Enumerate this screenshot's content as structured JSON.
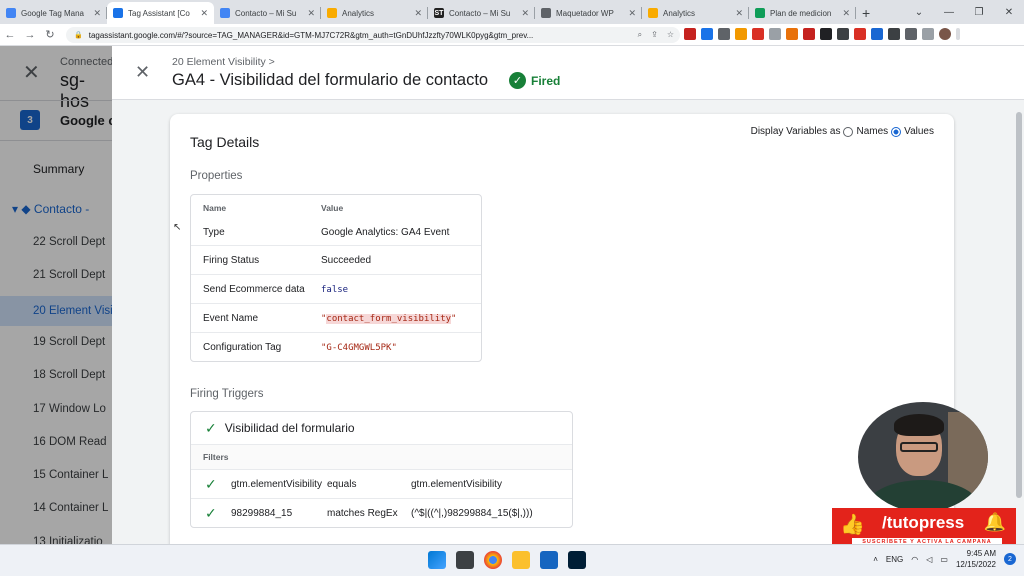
{
  "tabs": [
    {
      "title": "Google Tag Mana",
      "favicon_color": "#4285f4",
      "active": false
    },
    {
      "title": "Tag Assistant [Co",
      "favicon_color": "#1a73e8",
      "active": true
    },
    {
      "title": "Contacto – Mi Su",
      "favicon_color": "#4285f4",
      "active": false
    },
    {
      "title": "Analytics",
      "favicon_color": "#f9ab00",
      "active": false
    },
    {
      "title": "Contacto – Mi Su",
      "favicon_color": "#222222",
      "favicon_text": "ST",
      "active": false
    },
    {
      "title": "Maquetador WP",
      "favicon_color": "#5f6368",
      "active": false
    },
    {
      "title": "Analytics",
      "favicon_color": "#f9ab00",
      "active": false
    },
    {
      "title": "Plan de medicion",
      "favicon_color": "#0f9d58",
      "active": false
    }
  ],
  "browser": {
    "url": "tagassistant.google.com/#/?source=TAG_MANAGER&id=GTM-MJ7C72R&gtm_auth=tGnDUhfJzzfty70WLK0pyg&gtm_prev..."
  },
  "left_panel": {
    "connected_label": "Connected",
    "host": "sg-hos",
    "page_number": "3",
    "page_label": "Google c",
    "summary": "Summary",
    "container": "Contacto -",
    "events": [
      {
        "label": "22 Scroll Dept",
        "selected": false
      },
      {
        "label": "21 Scroll Dept",
        "selected": false
      },
      {
        "label": "20 Element Visi",
        "selected": true
      },
      {
        "label": "19 Scroll Dept",
        "selected": false
      },
      {
        "label": "18 Scroll Dept",
        "selected": false
      },
      {
        "label": "17 Window Lo",
        "selected": false
      },
      {
        "label": "16 DOM Read",
        "selected": false
      },
      {
        "label": "15 Container L",
        "selected": false
      },
      {
        "label": "14 Container L",
        "selected": false
      },
      {
        "label": "13 Initializatio",
        "selected": false
      }
    ]
  },
  "panel": {
    "breadcrumb": "20 Element Visibility >",
    "title": "GA4 - Visibilidad del formulario de contacto",
    "status": "Fired"
  },
  "card": {
    "title": "Tag Details",
    "display_variables_label": "Display Variables as",
    "option_names": "Names",
    "option_values": "Values",
    "selected_option": "Values",
    "properties_heading": "Properties",
    "properties_header": {
      "name": "Name",
      "value": "Value"
    },
    "properties": [
      {
        "name": "Type",
        "value": "Google Analytics: GA4 Event",
        "style": "plain"
      },
      {
        "name": "Firing Status",
        "value": "Succeeded",
        "style": "plain"
      },
      {
        "name": "Send Ecommerce data",
        "value": "false",
        "style": "keyword"
      },
      {
        "name": "Event Name",
        "value": "contact_form_visibility",
        "style": "string-highlight"
      },
      {
        "name": "Configuration Tag",
        "value": "G-C4GMGWL5PK",
        "style": "string"
      }
    ],
    "triggers_heading": "Firing Triggers",
    "trigger_name": "Visibilidad del formulario",
    "filters_label": "Filters",
    "filters": [
      {
        "variable": "gtm.elementVisibility",
        "operator": "equals",
        "value": "gtm.elementVisibility"
      },
      {
        "variable": "98299884_15",
        "operator": "matches RegEx",
        "value": "(^$|((^|,)98299884_15($|,)))"
      }
    ]
  },
  "taskbar": {
    "language": "ENG",
    "time": "9:45 AM",
    "date": "12/15/2022",
    "notifications": "2"
  },
  "overlay": {
    "brand": "/tutopress",
    "tagline": "SUSCRÍBETE Y ACTIVA LA CAMPANA"
  },
  "colors": {
    "accent": "#1967d2",
    "success": "#188038",
    "promo": "#e3231b"
  }
}
